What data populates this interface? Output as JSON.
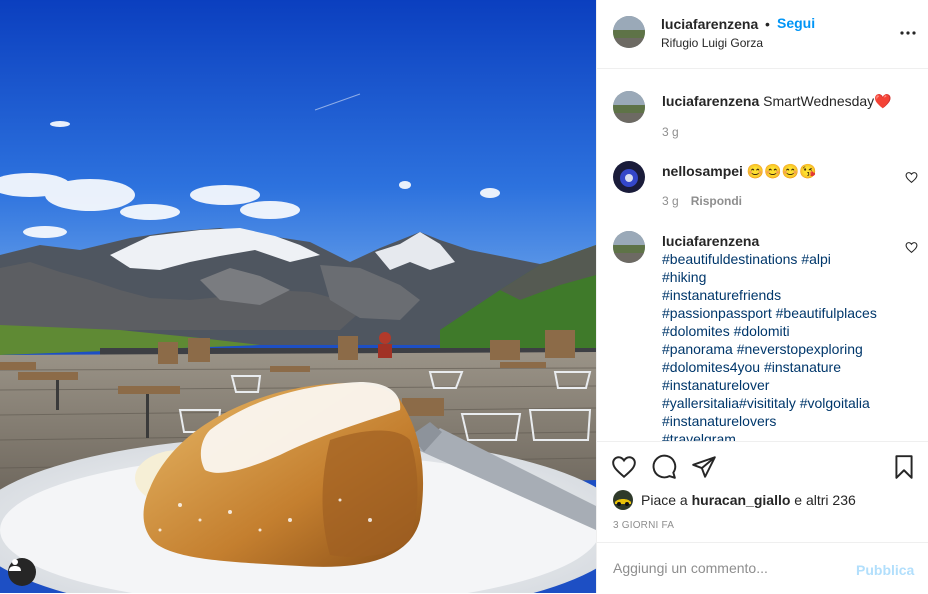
{
  "post": {
    "author": "luciafarenzena",
    "separator": "•",
    "follow_label": "Segui",
    "location": "Rifugio Luigi Gorza"
  },
  "comments": [
    {
      "user": "luciafarenzena",
      "text": "SmartWednesday",
      "emoji": "❤️",
      "time": "3 g"
    },
    {
      "user": "nellosampei",
      "text": "😊😊😊😘",
      "time": "3 g",
      "reply_label": "Rispondi"
    },
    {
      "user": "luciafarenzena",
      "tags": [
        "#beautifuldestinations #alpi",
        "#hiking",
        "#instanaturefriends",
        "#passionpassport #beautifulplaces",
        "#dolomites #dolomiti",
        "#panorama #neverstopexploring",
        "#dolomites4you #instanature",
        "#instanaturelover",
        "#yallersitalia#visititaly #volgoitalia",
        "#instanaturelovers",
        "#travelgram"
      ]
    }
  ],
  "likes": {
    "prefix": "Piace a",
    "user": "huracan_giallo",
    "suffix": "e altri 236"
  },
  "timestamp": "3 GIORNI FA",
  "add_comment": {
    "placeholder": "Aggiungi un commento...",
    "post_label": "Pubblica"
  },
  "icons": {
    "more": "more-dots-icon",
    "like": "heart-icon",
    "comment": "comment-bubble-icon",
    "share": "paper-plane-icon",
    "save": "bookmark-icon",
    "user_tag": "user-icon"
  },
  "colors": {
    "link_blue": "#0095f6",
    "hashtag": "#00376b",
    "muted": "#8e8e8e",
    "heart_red": "#ed4956",
    "post_disabled": "#b2dffc"
  }
}
